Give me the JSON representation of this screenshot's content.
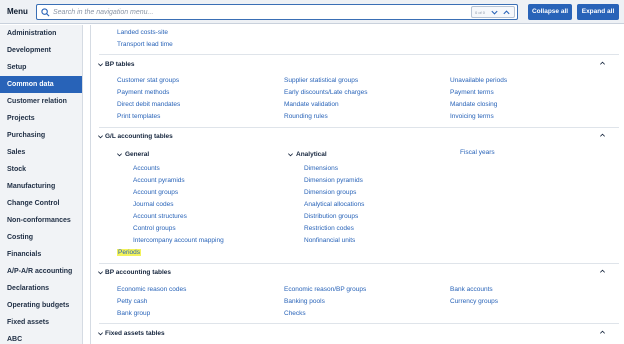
{
  "topbar": {
    "menu_label": "Menu",
    "search_placeholder": "Search in the navigation menu...",
    "count": "0 of 0",
    "collapse_all": "Collapse all",
    "expand_all": "Expand all"
  },
  "sidebar": {
    "items": [
      {
        "label": "Administration"
      },
      {
        "label": "Development"
      },
      {
        "label": "Setup"
      },
      {
        "label": "Common data"
      },
      {
        "label": "Customer relation"
      },
      {
        "label": "Projects"
      },
      {
        "label": "Purchasing"
      },
      {
        "label": "Sales"
      },
      {
        "label": "Stock"
      },
      {
        "label": "Manufacturing"
      },
      {
        "label": "Change Control"
      },
      {
        "label": "Non-conformances"
      },
      {
        "label": "Costing"
      },
      {
        "label": "Financials"
      },
      {
        "label": "A/P-A/R accounting"
      },
      {
        "label": "Declarations"
      },
      {
        "label": "Operating budgets"
      },
      {
        "label": "Fixed assets"
      },
      {
        "label": "ABC"
      }
    ],
    "active_label": "Common data"
  },
  "main": {
    "top_links": [
      "Landed costs-site",
      "Transport lead time"
    ],
    "bp_tables": {
      "title": "BP tables",
      "col1": [
        "Customer stat groups",
        "Payment methods",
        "Direct debit mandates",
        "Print templates"
      ],
      "col2": [
        "Supplier statistical groups",
        "Early discounts/Late charges",
        "Mandate validation",
        "Rounding rules"
      ],
      "col3": [
        "Unavailable periods",
        "Payment terms",
        "Mandate closing",
        "Invoicing terms"
      ]
    },
    "gl_tables": {
      "title": "G/L accounting tables",
      "general": {
        "title": "General",
        "items": [
          "Accounts",
          "Account pyramids",
          "Account groups",
          "Journal codes",
          "Account structures",
          "Control groups",
          "Intercompany account mapping"
        ]
      },
      "analytical": {
        "title": "Analytical",
        "items": [
          "Dimensions",
          "Dimension pyramids",
          "Dimension groups",
          "Analytical allocations",
          "Distribution groups",
          "Restriction codes",
          "Nonfinancial units"
        ]
      },
      "fiscal_years": "Fiscal years",
      "periods": "Periods"
    },
    "bp_accounting": {
      "title": "BP accounting tables",
      "col1": [
        "Economic reason codes",
        "Petty cash",
        "Bank group"
      ],
      "col2": [
        "Economic reason/BP groups",
        "Banking pools",
        "Checks"
      ],
      "col3": [
        "Bank accounts",
        "Currency groups"
      ]
    },
    "fixed_assets": {
      "title": "Fixed assets tables"
    }
  },
  "colors": {
    "accent": "#2863b8",
    "link": "#2863b8",
    "highlight": "#f3f35a"
  }
}
